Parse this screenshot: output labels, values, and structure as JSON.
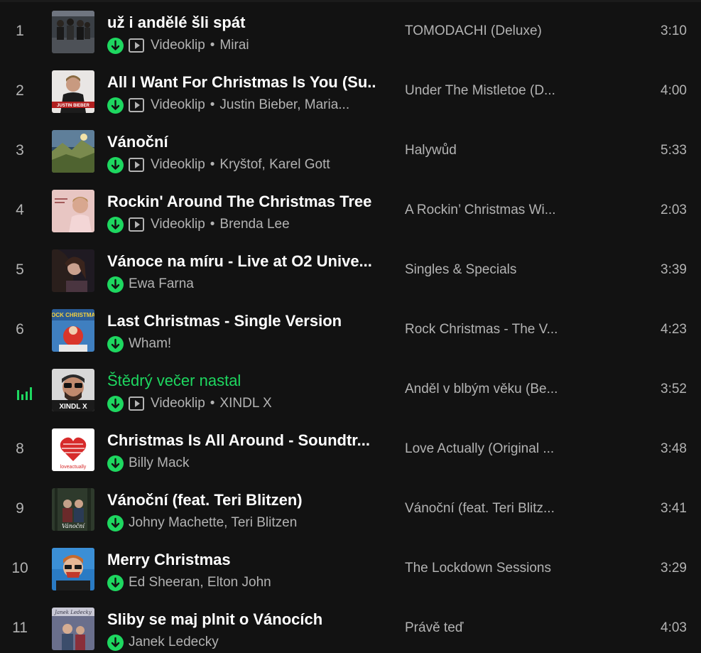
{
  "colors": {
    "background": "#121212",
    "accent": "#1ed760",
    "primary_text": "#ffffff",
    "secondary_text": "#b3b3b3"
  },
  "tracks": [
    {
      "num": "1",
      "title": "už i andělé šli spát",
      "video": "Videoklip",
      "dot": "•",
      "artists": "Mirai",
      "album": "TOMODACHI (Deluxe)",
      "duration": "3:10",
      "cover": "group-photo"
    },
    {
      "num": "2",
      "title": "All I Want For Christmas Is You (Su...",
      "video": "Videoklip",
      "dot": "•",
      "artists": "Justin Bieber, Maria...",
      "album": "Under The Mistletoe (D...",
      "duration": "4:00",
      "cover": "portrait-red"
    },
    {
      "num": "3",
      "title": "Vánoční",
      "video": "Videoklip",
      "dot": "•",
      "artists": "Kryštof, Karel Gott",
      "album": "Halywůd",
      "duration": "5:33",
      "cover": "landscape"
    },
    {
      "num": "4",
      "title": "Rockin' Around The Christmas Tree",
      "video": "Videoklip",
      "dot": "•",
      "artists": "Brenda Lee",
      "album": "A Rockin’ Christmas Wi...",
      "duration": "2:03",
      "cover": "pink-portrait"
    },
    {
      "num": "5",
      "title": "Vánoce na míru - Live at O2 Unive...",
      "video": "",
      "dot": "",
      "artists": "Ewa Farna",
      "album": "Singles & Specials",
      "duration": "3:39",
      "cover": "dark-portrait"
    },
    {
      "num": "6",
      "title": "Last Christmas - Single Version",
      "video": "",
      "dot": "",
      "artists": "Wham!",
      "album": "Rock Christmas - The V...",
      "duration": "4:23",
      "cover": "rock-christmas"
    },
    {
      "num": "",
      "title": "Štědrý večer nastal",
      "video": "Videoklip",
      "dot": "•",
      "artists": "XINDL X",
      "album": "Anděl v blbým věku (Be...",
      "duration": "3:52",
      "cover": "xindl",
      "playing": true
    },
    {
      "num": "8",
      "title": "Christmas Is All Around - Soundtr...",
      "video": "",
      "dot": "",
      "artists": "Billy Mack",
      "album": "Love Actually (Original ...",
      "duration": "3:48",
      "cover": "love-actually"
    },
    {
      "num": "9",
      "title": "Vánoční (feat. Teri Blitzen)",
      "video": "",
      "dot": "",
      "artists": "Johny Machette, Teri Blitzen",
      "album": "Vánoční (feat. Teri Blitz...",
      "duration": "3:41",
      "cover": "forest-group"
    },
    {
      "num": "10",
      "title": "Merry Christmas",
      "video": "",
      "dot": "",
      "artists": "Ed Sheeran, Elton John",
      "album": "The Lockdown Sessions",
      "duration": "3:29",
      "cover": "sheeran"
    },
    {
      "num": "11",
      "title": "Sliby se maj plnit o Vánocích",
      "video": "",
      "dot": "",
      "artists": "Janek Ledecky",
      "album": "Právě teď",
      "duration": "4:03",
      "cover": "ledecky"
    }
  ],
  "cover_text": {
    "justin_bieber": "JUSTIN BIEBER",
    "rock_christmas": "ROCK CHRISTMAS",
    "xindl": "XINDL X",
    "love_actually": "loveactually",
    "vanocni": "Vánoční",
    "ledecky": "Janek Ledecky"
  }
}
